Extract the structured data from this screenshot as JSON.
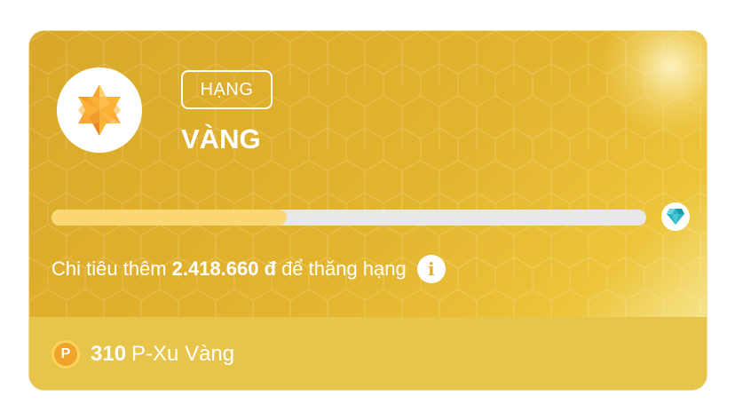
{
  "rank": {
    "label": "HẠNG",
    "name": "VÀNG"
  },
  "progress": {
    "fraction": 0.395,
    "fill_color": "#fbd774",
    "next_tier_icon": "diamond-icon"
  },
  "spend": {
    "prefix": "Chi tiêu thêm",
    "amount": "2.418.660 đ",
    "suffix": "để thăng hạng"
  },
  "coins": {
    "icon_letter": "P",
    "amount": "310",
    "label": "P-Xu Vàng"
  },
  "colors": {
    "card_gold": "#e0b12e",
    "footer_gold": "#e7c44a",
    "star_orange": "#f7a634"
  }
}
